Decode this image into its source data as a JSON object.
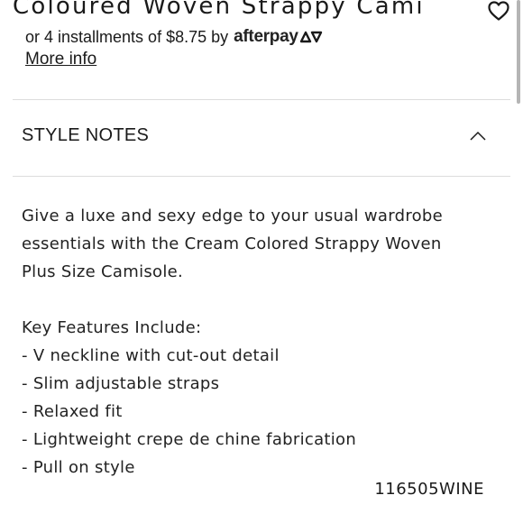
{
  "product": {
    "title": "Coloured Woven Strappy Cami",
    "sku": "116505WINE"
  },
  "payment": {
    "installments_text": "or 4 installments of $8.75 by",
    "provider_name": "afterpay",
    "more_info_label": "More info"
  },
  "style_notes": {
    "heading": "STYLE NOTES",
    "expanded": true,
    "intro_lines": [
      "Give a luxe and sexy edge to your usual wardrobe",
      "essentials with the Cream Colored Strappy Woven",
      "Plus Size Camisole."
    ],
    "features_heading": "Key Features Include:",
    "features": [
      "- V neckline with cut-out detail",
      "- Slim adjustable straps",
      "- Relaxed fit",
      "- Lightweight crepe de chine fabrication",
      "- Pull on style"
    ]
  },
  "icons": {
    "wishlist": "heart-outline-icon",
    "collapse": "chevron-up-icon",
    "afterpay": "afterpay-logo-icon"
  },
  "colors": {
    "text": "#1a1a1a",
    "divider": "#dcdcdc",
    "background": "#ffffff"
  }
}
